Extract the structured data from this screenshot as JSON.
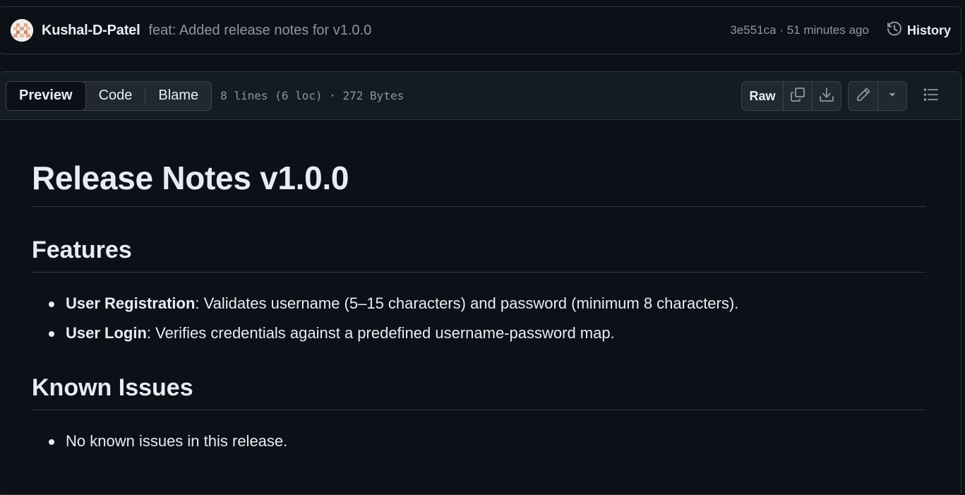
{
  "commit": {
    "author": "Kushal-D-Patel",
    "message": "feat: Added release notes for v1.0.0",
    "meta": "3e551ca · 51 minutes ago",
    "history_label": "History"
  },
  "file_header": {
    "tabs": [
      "Preview",
      "Code",
      "Blame"
    ],
    "active_tab": "Preview",
    "file_info": "8 lines (6 loc) · 272 Bytes",
    "raw_label": "Raw",
    "icons": [
      "copy-icon",
      "download-icon",
      "pencil-icon",
      "triangle-down-icon",
      "list-unordered-icon"
    ]
  },
  "markdown": {
    "title": "Release Notes v1.0.0",
    "features_heading": "Features",
    "features": [
      {
        "bold": "User Registration",
        "text": ": Validates username (5–15 characters) and password (minimum 8 characters)."
      },
      {
        "bold": "User Login",
        "text": ": Verifies credentials against a predefined username-password map."
      }
    ],
    "issues_heading": "Known Issues",
    "issues": [
      {
        "text": "No known issues in this release."
      }
    ]
  },
  "colors": {
    "background": "#0d1117",
    "header_bg": "#151b23",
    "border": "#30363d",
    "text": "#e6edf3",
    "muted": "#8d96a0"
  }
}
